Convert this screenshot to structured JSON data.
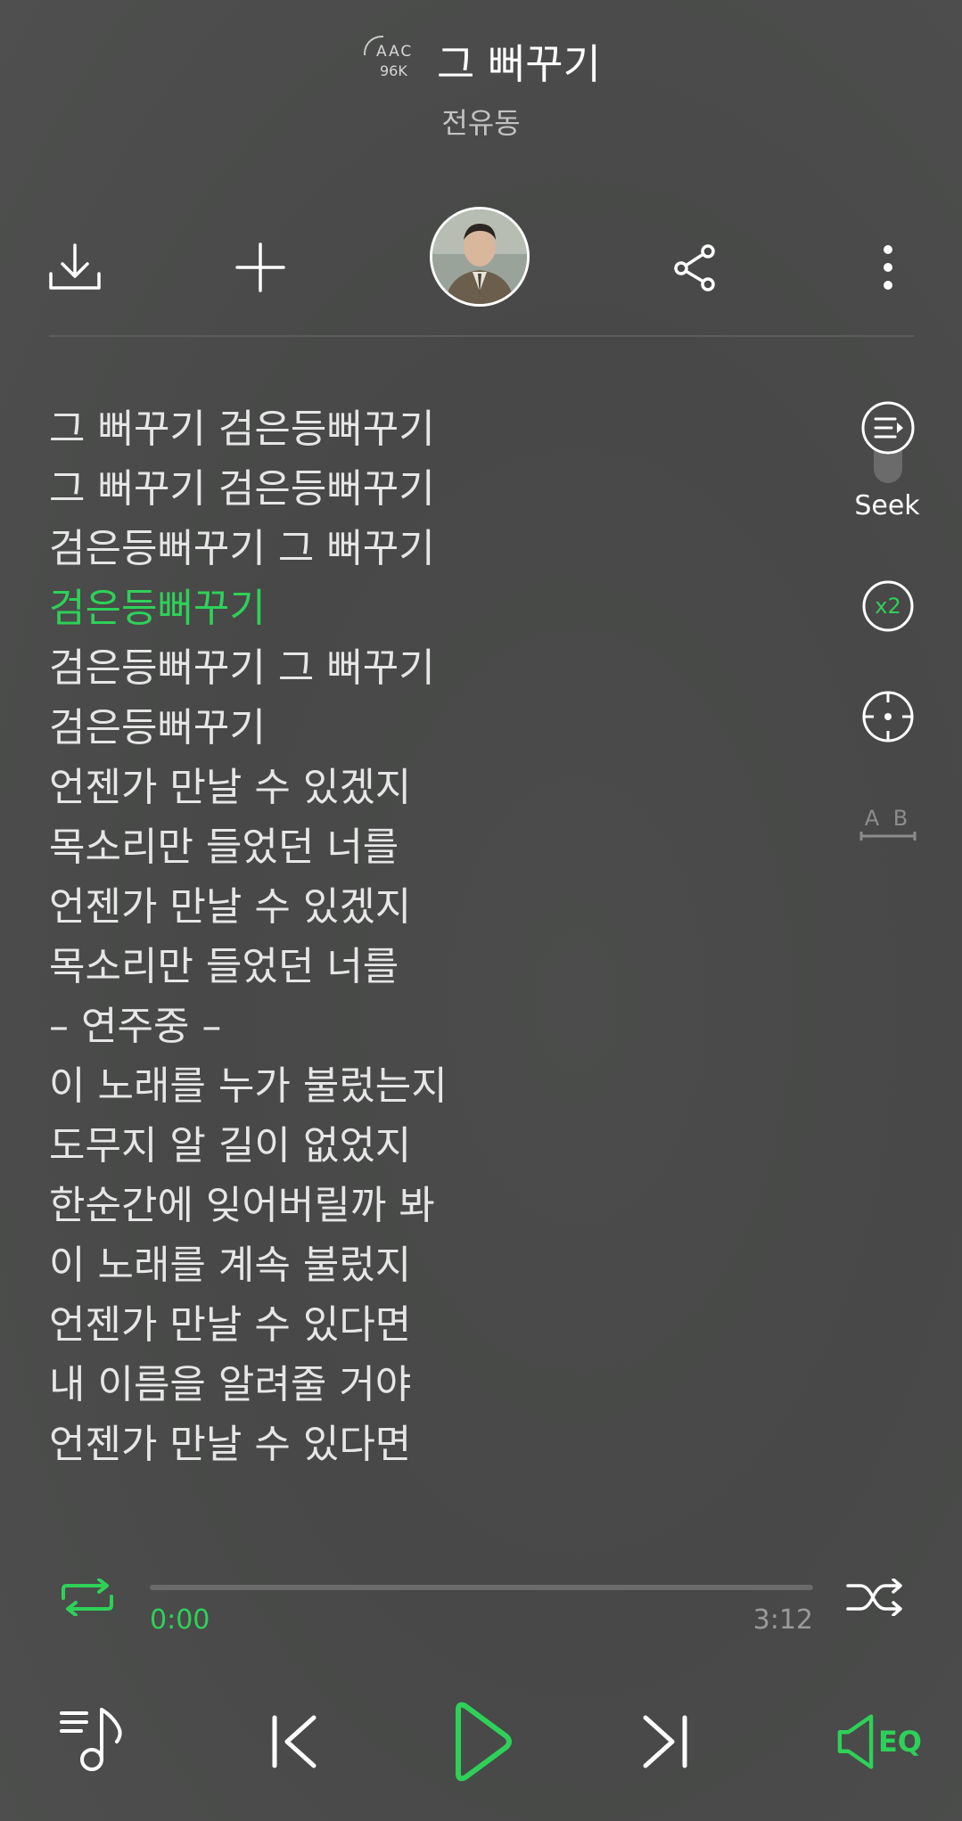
{
  "header": {
    "codec_line1": "AAC",
    "codec_line2": "96K",
    "title": "그 뻐꾸기",
    "artist": "전유동"
  },
  "actions": {
    "download_icon": "download-icon",
    "add_icon": "plus-icon",
    "share_icon": "share-icon",
    "more_icon": "more-vertical-icon"
  },
  "lyrics": [
    "그 뻐꾸기 검은등뻐꾸기",
    "그 뻐꾸기 검은등뻐꾸기",
    "검은등뻐꾸기 그 뻐꾸기",
    "검은등뻐꾸기",
    "검은등뻐꾸기 그 뻐꾸기",
    "검은등뻐꾸기",
    "언젠가 만날 수 있겠지",
    "목소리만 들었던 너를",
    "언젠가 만날 수 있겠지",
    "목소리만 들었던 너를",
    "– 연주중 –",
    "이 노래를 누가 불렀는지",
    "도무지 알 길이 없었지",
    "한순간에 잊어버릴까 봐",
    "이 노래를 계속 불렀지",
    "언젠가 만날 수 있다면",
    "내 이름을 알려줄 거야",
    "언젠가 만날 수 있다면"
  ],
  "current_lyric_index": 3,
  "side_tools": {
    "seek_label": "Seek",
    "speed_label": "x2",
    "ab_label": "A B"
  },
  "progress": {
    "current": "0:00",
    "total": "3:12",
    "fraction": 0
  },
  "controls": {
    "eq_label": "EQ"
  },
  "colors": {
    "accent": "#2ed158",
    "background": "#4a4b4a",
    "text": "#e6e6e6"
  }
}
